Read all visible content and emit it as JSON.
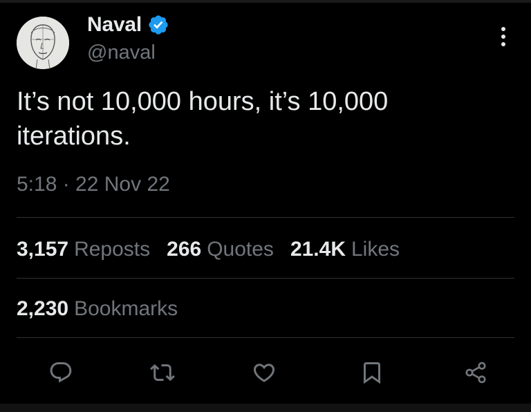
{
  "author": {
    "name": "Naval",
    "handle": "@naval",
    "verified": true
  },
  "icons": {
    "avatar": "avatar-sketch-icon",
    "verified": "verified-badge-icon",
    "more": "more-options-icon",
    "reply": "reply-icon",
    "repost": "repost-icon",
    "like": "heart-icon",
    "bookmark": "bookmark-icon",
    "share": "share-icon"
  },
  "tweet": {
    "text": "It’s not 10,000 hours, it’s 10,000 iterations.",
    "timestamp": "5:18 · 22 Nov 22"
  },
  "stats": {
    "reposts": {
      "count": "3,157",
      "label": "Reposts"
    },
    "quotes": {
      "count": "266",
      "label": "Quotes"
    },
    "likes": {
      "count": "21.4K",
      "label": "Likes"
    },
    "bookmarks": {
      "count": "2,230",
      "label": "Bookmarks"
    }
  },
  "colors": {
    "background": "#000000",
    "primary_text": "#e7e9ea",
    "secondary_text": "#71767b",
    "divider": "#2f3336",
    "verified_badge": "#1d9bf0"
  }
}
